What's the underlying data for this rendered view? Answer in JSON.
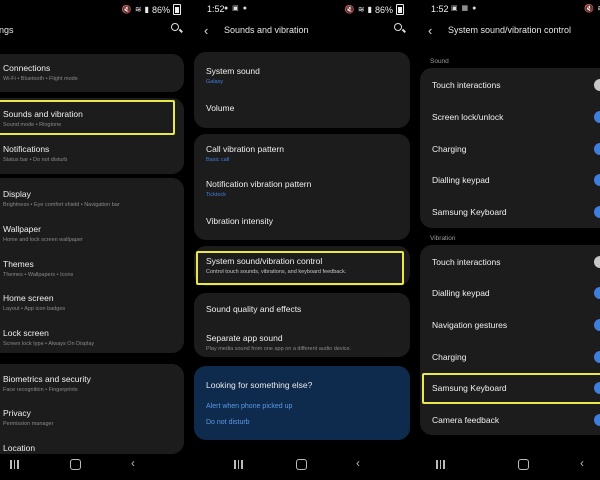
{
  "panel1": {
    "status": {
      "battery": "86%"
    },
    "title": "ngs",
    "items": [
      {
        "title": "Connections",
        "sub": "Wi-Fi • Bluetooth • Flight mode"
      },
      {
        "title": "Sounds and vibration",
        "sub": "Sound mode • Ringtone"
      },
      {
        "title": "Notifications",
        "sub": "Status bar • Do not disturb"
      },
      {
        "title": "Display",
        "sub": "Brightness • Eye comfort shield • Navigation bar"
      },
      {
        "title": "Wallpaper",
        "sub": "Home and lock screen wallpaper"
      },
      {
        "title": "Themes",
        "sub": "Themes • Wallpapers • Icons"
      },
      {
        "title": "Home screen",
        "sub": "Layout • App icon badges"
      },
      {
        "title": "Lock screen",
        "sub": "Screen lock type • Always On Display"
      },
      {
        "title": "Biometrics and security",
        "sub": "Face recognition • Fingerprints"
      },
      {
        "title": "Privacy",
        "sub": "Permission manager"
      },
      {
        "title": "Location",
        "sub": ""
      }
    ]
  },
  "panel2": {
    "status": {
      "time": "1:52",
      "battery": "86%"
    },
    "title": "Sounds and vibration",
    "items": [
      {
        "title": "System sound",
        "sub": "Galaxy"
      },
      {
        "title": "Volume",
        "sub": ""
      },
      {
        "title": "Call vibration pattern",
        "sub": "Basic call"
      },
      {
        "title": "Notification vibration pattern",
        "sub": "Ticktock"
      },
      {
        "title": "Vibration intensity",
        "sub": ""
      },
      {
        "title": "System sound/vibration control",
        "sub": "Control touch sounds, vibrations, and keyboard feedback."
      },
      {
        "title": "Sound quality and effects",
        "sub": ""
      },
      {
        "title": "Separate app sound",
        "sub": "Play media sound from one app on a different audio device."
      }
    ],
    "looking": {
      "title": "Looking for something else?",
      "links": [
        "Alert when phone picked up",
        "Do not disturb"
      ]
    }
  },
  "panel3": {
    "status": {
      "time": "1:52"
    },
    "title": "System sound/vibration control",
    "sections": [
      {
        "label": "Sound",
        "items": [
          {
            "title": "Touch interactions",
            "on": false
          },
          {
            "title": "Screen lock/unlock",
            "on": true
          },
          {
            "title": "Charging",
            "on": true
          },
          {
            "title": "Dialling keypad",
            "on": true
          },
          {
            "title": "Samsung Keyboard",
            "on": true
          }
        ]
      },
      {
        "label": "Vibration",
        "items": [
          {
            "title": "Touch interactions",
            "on": false
          },
          {
            "title": "Dialling keypad",
            "on": true
          },
          {
            "title": "Navigation gestures",
            "on": true
          },
          {
            "title": "Charging",
            "on": true
          },
          {
            "title": "Samsung Keyboard",
            "on": true
          },
          {
            "title": "Camera feedback",
            "on": true
          }
        ]
      }
    ]
  },
  "colors": {
    "highlight": "#e8e84a",
    "toggle_on": "#3e7ee0",
    "card": "#1c1c1c",
    "accent_link": "#3d7fe0"
  }
}
